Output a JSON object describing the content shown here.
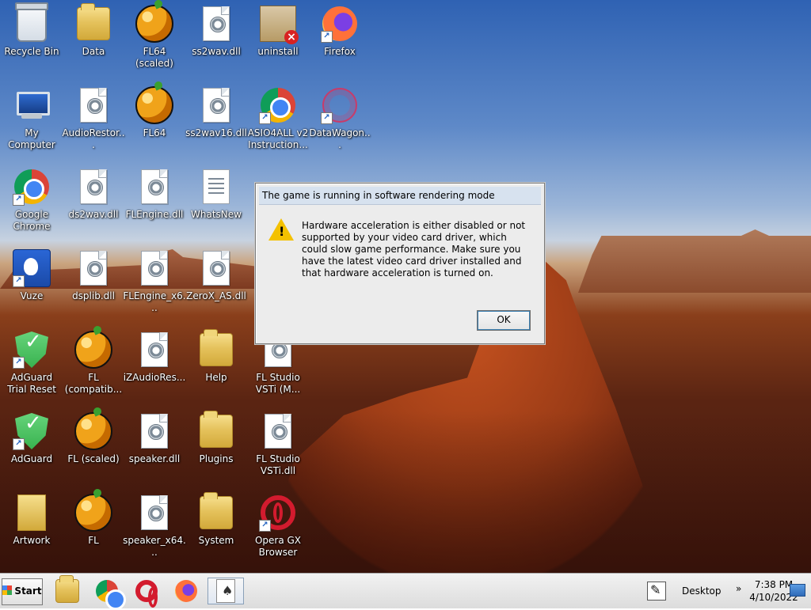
{
  "desktop": {
    "icons": [
      {
        "label": "Recycle Bin",
        "icon": "recycle-bin-icon"
      },
      {
        "label": "Data",
        "icon": "folder-icon"
      },
      {
        "label": "FL64 (scaled)",
        "icon": "fl-studio-icon"
      },
      {
        "label": "ss2wav.dll",
        "icon": "dll-file-icon"
      },
      {
        "label": "uninstall",
        "icon": "nsis-installer-icon"
      },
      {
        "label": "Firefox",
        "icon": "firefox-icon"
      },
      {
        "label": "My Computer",
        "icon": "computer-icon"
      },
      {
        "label": "AudioRestor...",
        "icon": "dll-file-icon"
      },
      {
        "label": "FL64",
        "icon": "fl-studio-icon"
      },
      {
        "label": "ss2wav16.dll",
        "icon": "dll-file-icon"
      },
      {
        "label": "ASIO4ALL v2 Instruction...",
        "icon": "chrome-icon"
      },
      {
        "label": "DataWagon...",
        "icon": "datawagon-icon"
      },
      {
        "label": "Google Chrome",
        "icon": "chrome-icon"
      },
      {
        "label": "ds2wav.dll",
        "icon": "dll-file-icon"
      },
      {
        "label": "FLEngine.dll",
        "icon": "dll-file-icon"
      },
      {
        "label": "WhatsNew",
        "icon": "text-document-icon"
      },
      {
        "label": "Vuze",
        "icon": "vuze-icon"
      },
      {
        "label": "dsplib.dll",
        "icon": "dll-file-icon"
      },
      {
        "label": "FLEngine_x6...",
        "icon": "dll-file-icon"
      },
      {
        "label": "ZeroX_AS.dll",
        "icon": "dll-file-icon"
      },
      {
        "label": "AdGuard Trial Reset",
        "icon": "adguard-shield-icon"
      },
      {
        "label": "FL (compatib...",
        "icon": "fl-studio-icon"
      },
      {
        "label": "iZAudioRes...",
        "icon": "dll-file-icon"
      },
      {
        "label": "Help",
        "icon": "folder-icon"
      },
      {
        "label": "FL Studio VSTi (M...",
        "icon": "dll-file-icon"
      },
      {
        "label": "AdGuard",
        "icon": "adguard-shield-icon"
      },
      {
        "label": "FL (scaled)",
        "icon": "fl-studio-icon"
      },
      {
        "label": "speaker.dll",
        "icon": "dll-file-icon"
      },
      {
        "label": "Plugins",
        "icon": "folder-icon"
      },
      {
        "label": "FL Studio VSTi.dll",
        "icon": "dll-file-icon"
      },
      {
        "label": "Artwork",
        "icon": "artwork-folder-icon"
      },
      {
        "label": "FL",
        "icon": "fl-studio-icon"
      },
      {
        "label": "speaker_x64...",
        "icon": "dll-file-icon"
      },
      {
        "label": "System",
        "icon": "folder-icon"
      },
      {
        "label": "Opera GX Browser",
        "icon": "opera-gx-icon"
      }
    ]
  },
  "dialog": {
    "title": "The game is running in software rendering mode",
    "message": "Hardware acceleration is either disabled or not supported by your video card driver, which could slow game performance. Make sure you have the latest video card driver installed and that hardware acceleration is turned on.",
    "ok_label": "OK"
  },
  "taskbar": {
    "start_label": "Start",
    "apps": [
      {
        "name": "file-explorer",
        "icon": "file-explorer-icon"
      },
      {
        "name": "chrome",
        "icon": "chrome-icon"
      },
      {
        "name": "opera-gx",
        "icon": "opera-gx-icon"
      },
      {
        "name": "firefox",
        "icon": "firefox-icon"
      },
      {
        "name": "cards-game",
        "icon": "cards-icon"
      }
    ],
    "tray": {
      "desktop_label": "Desktop",
      "time": "7:38 PM",
      "date": "4/10/2022",
      "chevron": "»"
    }
  }
}
